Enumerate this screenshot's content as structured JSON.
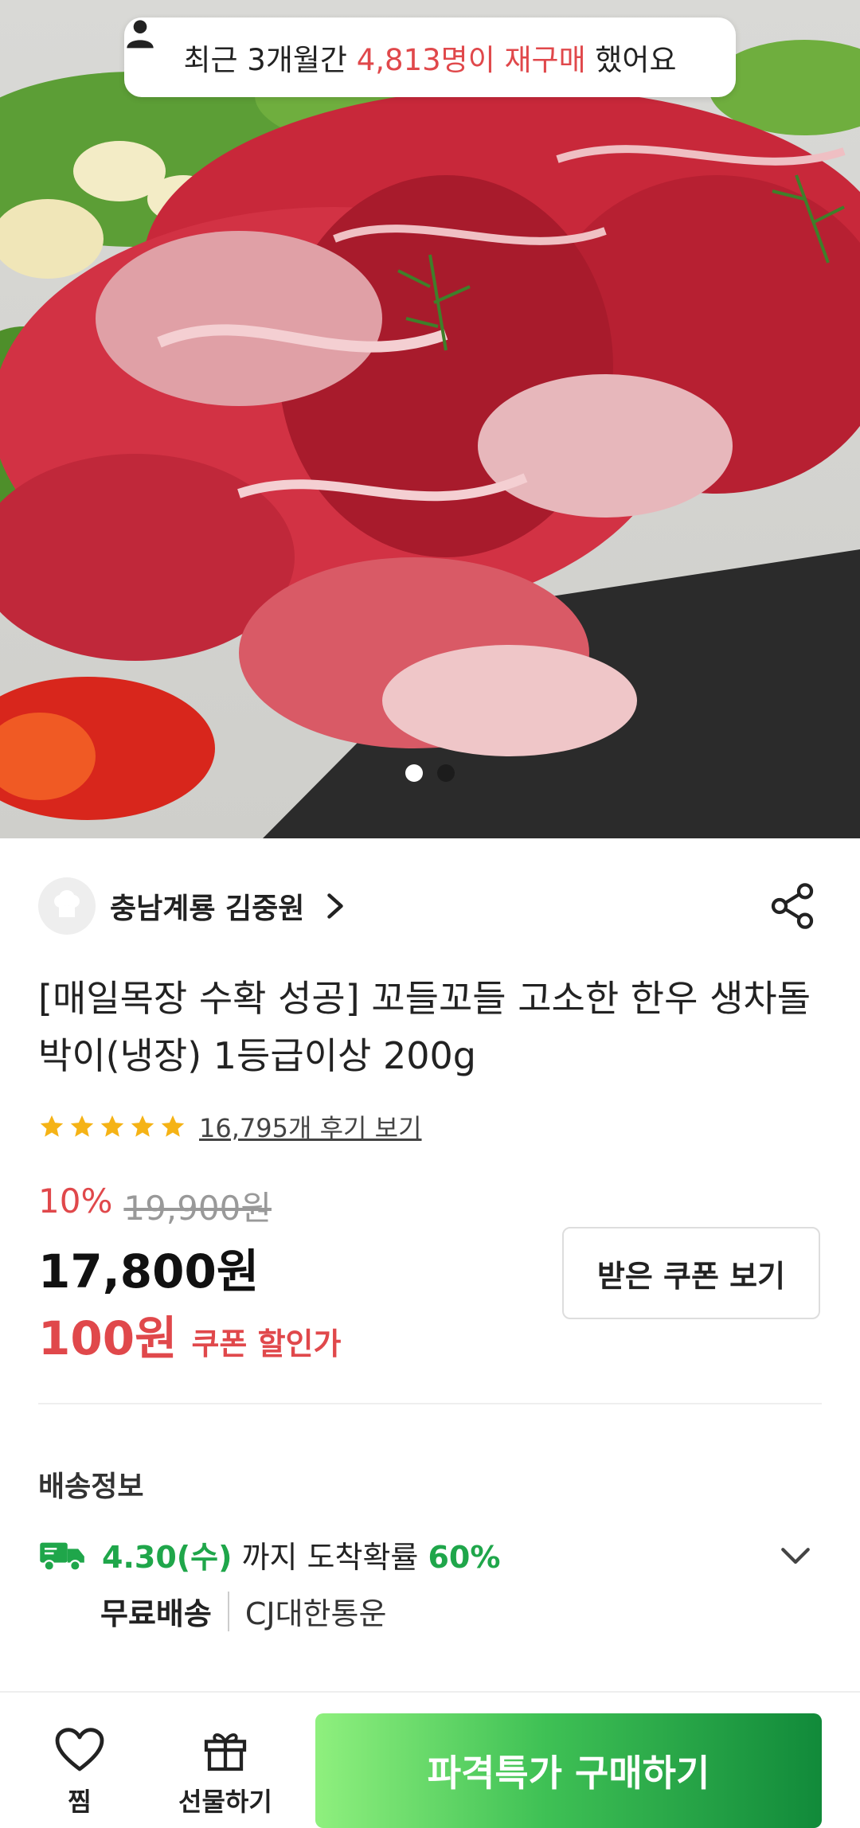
{
  "toast": {
    "prefix": "최근 3개월간 ",
    "highlight": "4,813명이 재구매",
    "suffix": " 했어요",
    "icon": "person-icon"
  },
  "carousel": {
    "image_alt": "hero-product-image",
    "total": 2,
    "current": 1
  },
  "seller": {
    "name": "충남계룡 김중원",
    "avatar_icon": "chef-hat-icon"
  },
  "product": {
    "title": "[매일목장 수확 성공] 꼬들꼬들 고소한 한우 생차돌박이(냉장) 1등급이상 200g",
    "rating": 5,
    "review_link": "16,795개 후기 보기"
  },
  "price": {
    "discount_rate": "10%",
    "original": "19,900원",
    "final": "17,800원",
    "coupon_amount": "100원",
    "coupon_label": "쿠폰 할인가",
    "coupon_button": "받은 쿠폰 보기"
  },
  "shipping": {
    "heading": "배송정보",
    "date": "4.30(수)",
    "text": " 까지 도착확률 ",
    "probability": "60%",
    "free": "무료배송",
    "carrier": "CJ대한통운"
  },
  "bottom": {
    "wish_label": "찜",
    "gift_label": "선물하기",
    "buy_label": "파격특가 구매하기"
  },
  "colors": {
    "accent_red": "#e0484b",
    "accent_green": "#1fa64a",
    "buy_gradient_start": "#8ff07e",
    "buy_gradient_end": "#118a3a"
  }
}
